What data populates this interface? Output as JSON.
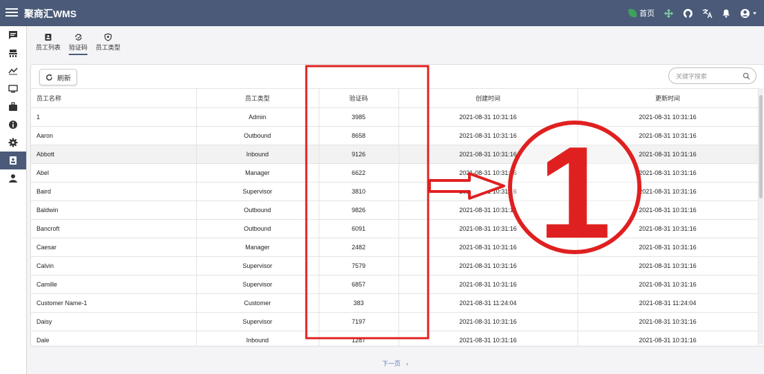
{
  "header": {
    "app_title": "聚商汇WMS",
    "home_label": "首页"
  },
  "tabs": [
    {
      "label": "员工列表",
      "icon": "badge-icon"
    },
    {
      "label": "验证码",
      "icon": "refresh-code-icon"
    },
    {
      "label": "员工类型",
      "icon": "shield-icon"
    }
  ],
  "active_tab": 1,
  "toolbar": {
    "refresh_label": "刷新",
    "search_placeholder": "关键字搜索"
  },
  "table": {
    "columns": [
      "员工名称",
      "员工类型",
      "验证码",
      "创建时间",
      "更新时间"
    ],
    "rows": [
      [
        "1",
        "Admin",
        "3985",
        "2021-08-31 10:31:16",
        "2021-08-31 10:31:16"
      ],
      [
        "Aaron",
        "Outbound",
        "8658",
        "2021-08-31 10:31:16",
        "2021-08-31 10:31:16"
      ],
      [
        "Abbott",
        "Inbound",
        "9126",
        "2021-08-31 10:31:16",
        "2021-08-31 10:31:16"
      ],
      [
        "Abel",
        "Manager",
        "6622",
        "2021-08-31 10:31:16",
        "2021-08-31 10:31:16"
      ],
      [
        "Baird",
        "Supervisor",
        "3810",
        "2021-08-31 10:31:16",
        "2021-08-31 10:31:16"
      ],
      [
        "Baldwin",
        "Outbound",
        "9826",
        "2021-08-31 10:31:16",
        "2021-08-31 10:31:16"
      ],
      [
        "Bancroft",
        "Outbound",
        "6091",
        "2021-08-31 10:31:16",
        "2021-08-31 10:31:16"
      ],
      [
        "Caesar",
        "Manager",
        "2482",
        "2021-08-31 10:31:16",
        "2021-08-31 10:31:16"
      ],
      [
        "Calvin",
        "Supervisor",
        "7579",
        "2021-08-31 10:31:16",
        "2021-08-31 10:31:16"
      ],
      [
        "Camille",
        "Supervisor",
        "6857",
        "2021-08-31 10:31:16",
        "2021-08-31 10:31:16"
      ],
      [
        "Customer Name-1",
        "Customer",
        "383",
        "2021-08-31 11:24:04",
        "2021-08-31 11:24:04"
      ],
      [
        "Daisy",
        "Supervisor",
        "7197",
        "2021-08-31 10:31:16",
        "2021-08-31 10:31:16"
      ],
      [
        "Dale",
        "Inbound",
        "1287",
        "2021-08-31 10:31:16",
        "2021-08-31 10:31:16"
      ]
    ],
    "highlighted_row": 2
  },
  "pager": {
    "next_label": "下一页",
    "next_arrow": "›"
  },
  "annotation": {
    "marker": "①",
    "color": "#e02020"
  },
  "colors": {
    "header_bg": "#4a5a78",
    "accent": "#4a5a78"
  }
}
